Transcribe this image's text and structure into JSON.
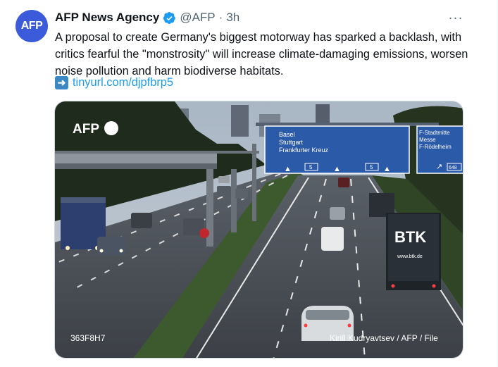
{
  "tweet": {
    "avatar_text": "AFP",
    "name": "AFP News Agency",
    "handle": "@AFP",
    "separator": "·",
    "time": "3h",
    "more_label": "···",
    "text": "A proposal to create Germany's biggest motorway has sparked a backlash, with critics fearful the \"monstrosity\" will increase climate-damaging emissions, worsen noise pollution and harm biodiverse habitats.",
    "link_icon": "right-arrow-emoji",
    "link_text": "tinyurl.com/djpfbrp5"
  },
  "photo": {
    "logo": "AFP",
    "code": "363F8H7",
    "credit": "Kirill Kudryavtsev / AFP / File",
    "sign_main": [
      "Basel",
      "Stuttgart",
      "Frankfurter Kreuz"
    ],
    "sign_route_1": "5",
    "sign_route_2": "5",
    "sign_right": [
      "F-Stadtmitte",
      "Messe",
      "F-Rödelheim"
    ],
    "sign_right_exit": "648",
    "truck_brand": "BTK",
    "truck_web": "www.btk.de"
  },
  "colors": {
    "accent": "#1d9bf0",
    "avatar_bg": "#3b5bdb",
    "verified": "#1d9bf0",
    "sign_blue": "#2b5aa8"
  }
}
